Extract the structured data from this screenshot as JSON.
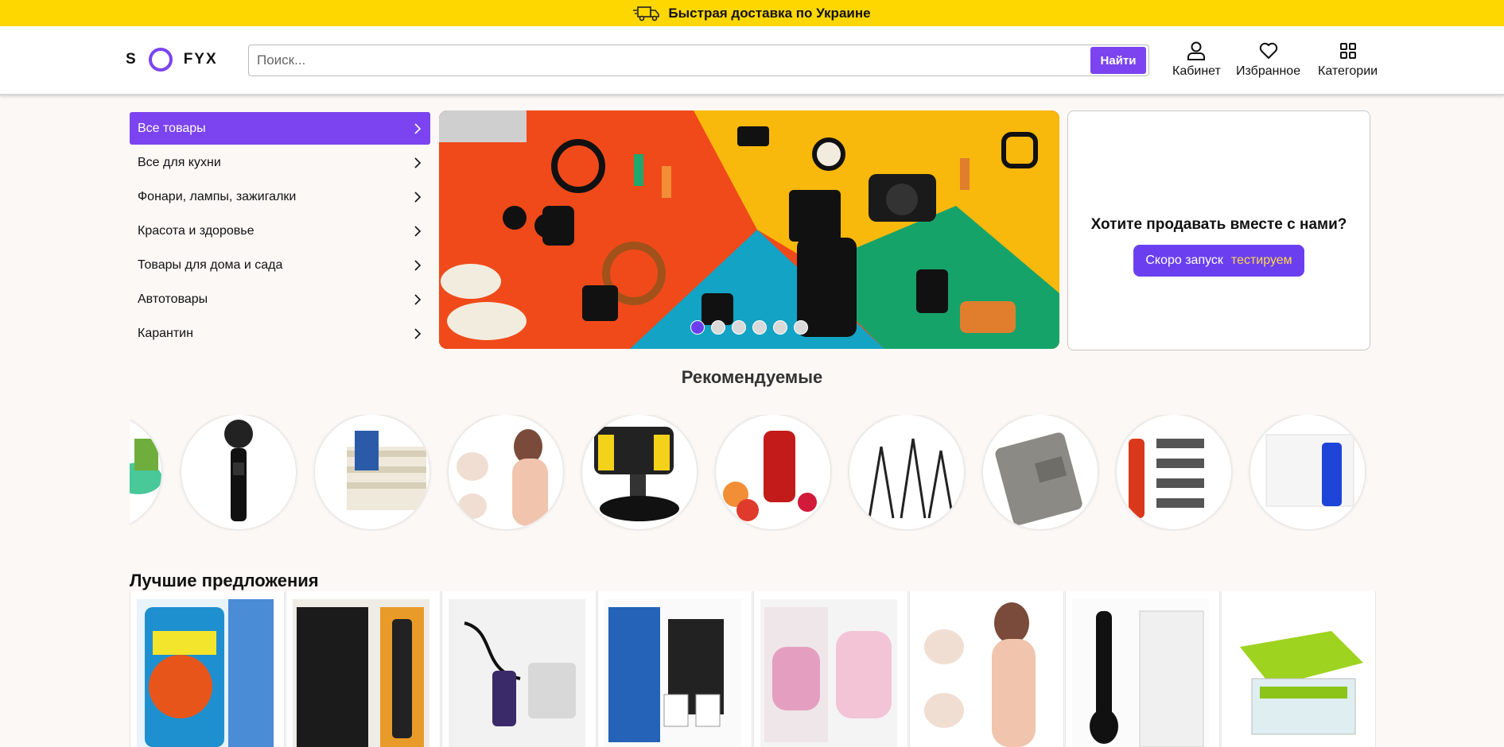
{
  "topbar": {
    "text": "Быстрая доставка по Украине",
    "icon": "truck-icon"
  },
  "header": {
    "logo": {
      "left": "S",
      "right": "FYX"
    },
    "search": {
      "placeholder": "Поиск...",
      "button": "Найти"
    },
    "nav": [
      {
        "label": "Кабинет",
        "icon": "user-icon"
      },
      {
        "label": "Избранное",
        "icon": "heart-icon"
      },
      {
        "label": "Категории",
        "icon": "grid-icon"
      }
    ]
  },
  "sidebar": {
    "items": [
      {
        "label": "Все товары",
        "active": true
      },
      {
        "label": "Все для кухни"
      },
      {
        "label": "Фонари, лампы, зажигалки"
      },
      {
        "label": "Красота и здоровье"
      },
      {
        "label": "Товары для дома и сада"
      },
      {
        "label": "Автотовары"
      },
      {
        "label": "Карантин"
      }
    ]
  },
  "banner": {
    "slides": 6,
    "active_slide": 1
  },
  "sell": {
    "title": "Хотите продавать вместе с нами?",
    "button": "Скоро запуск",
    "tag": "тестируем"
  },
  "recommended": {
    "title": "Рекомендуемые",
    "items": [
      "sponge",
      "karaoke-microphone",
      "insoles",
      "silicone-bra",
      "car-phone-holder",
      "juicer",
      "tripods",
      "wallet",
      "trimmer",
      "usb-lighter"
    ]
  },
  "best": {
    "title": "Лучшие предложения",
    "items": [
      "better-sponge",
      "gift-lighter",
      "nail-drill",
      "coffee-maker",
      "lint-remover",
      "silicone-bra",
      "kitchen-scale-spoon",
      "vegetable-slicer"
    ]
  },
  "colors": {
    "accent": "#7b44f0",
    "topbar": "#ffd700",
    "tag": "#ffd94a"
  }
}
